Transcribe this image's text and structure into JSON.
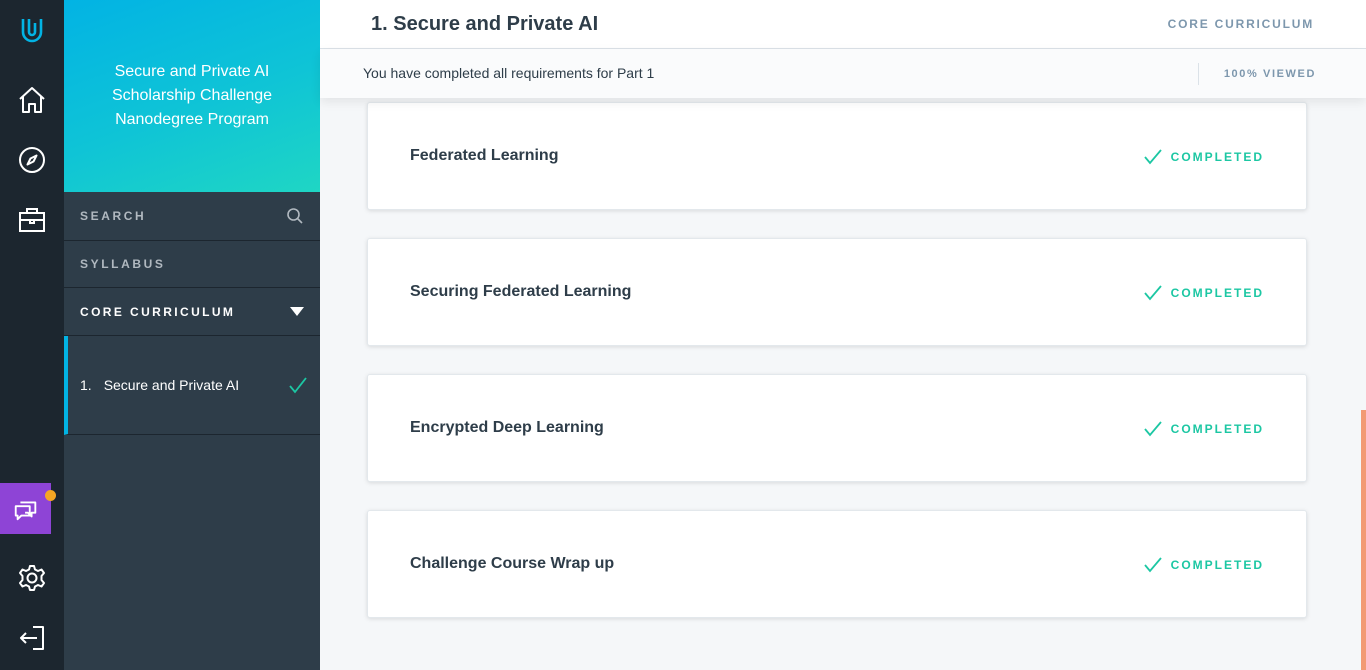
{
  "rail": {
    "icons": [
      "udacity-logo-icon",
      "home-icon",
      "compass-icon",
      "briefcase-icon",
      "chat-icon",
      "gear-icon",
      "logout-icon"
    ]
  },
  "sidebar": {
    "program_title": "Secure and Private AI Scholarship Challenge Nanodegree Program",
    "search_label": "SEARCH",
    "syllabus_label": "SYLLABUS",
    "core_label": "CORE CURRICULUM",
    "lesson": {
      "number": "1.",
      "title": "Secure and Private AI"
    }
  },
  "header": {
    "title": "1. Secure and Private AI",
    "section": "CORE CURRICULUM"
  },
  "subheader": {
    "message": "You have completed all requirements for Part 1",
    "viewed": "100% VIEWED"
  },
  "lessons": [
    {
      "title": "Federated Learning",
      "status": "COMPLETED"
    },
    {
      "title": "Securing Federated Learning",
      "status": "COMPLETED"
    },
    {
      "title": "Encrypted Deep Learning",
      "status": "COMPLETED"
    },
    {
      "title": "Challenge Course Wrap up",
      "status": "COMPLETED"
    }
  ],
  "colors": {
    "rail_bg": "#1c262f",
    "sidebar_bg": "#2e3d49",
    "accent_blue": "#02b3e4",
    "completed_green": "#1cc7a3",
    "chat_purple": "#8e44d6",
    "notification_orange": "#f5a623"
  }
}
